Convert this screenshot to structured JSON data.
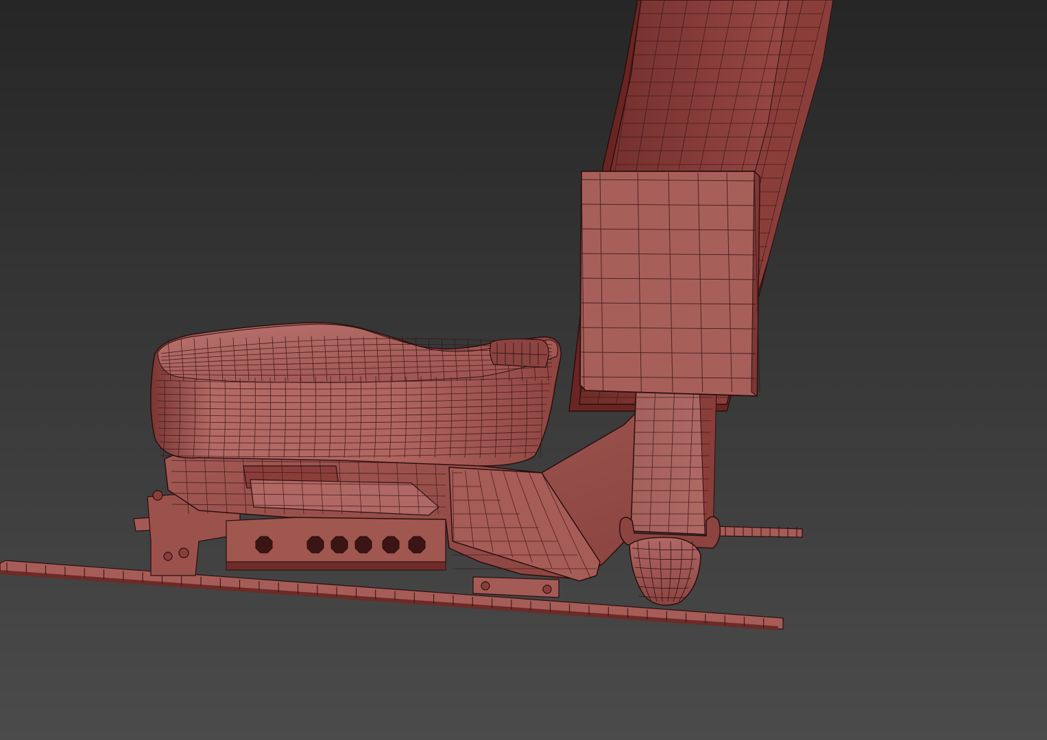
{
  "scene": {
    "subject": "car-seat-wireframe",
    "colors": {
      "bg_top": "#262626",
      "bg_bottom": "#4a4a4a",
      "mesh_fill_light": "#b86a66",
      "mesh_fill": "#a85a56",
      "mesh_fill_dark": "#7a3a37",
      "mesh_fill_darker": "#5a2624",
      "wire": "#3a1514",
      "wire_edge": "#2a0e0d"
    }
  }
}
